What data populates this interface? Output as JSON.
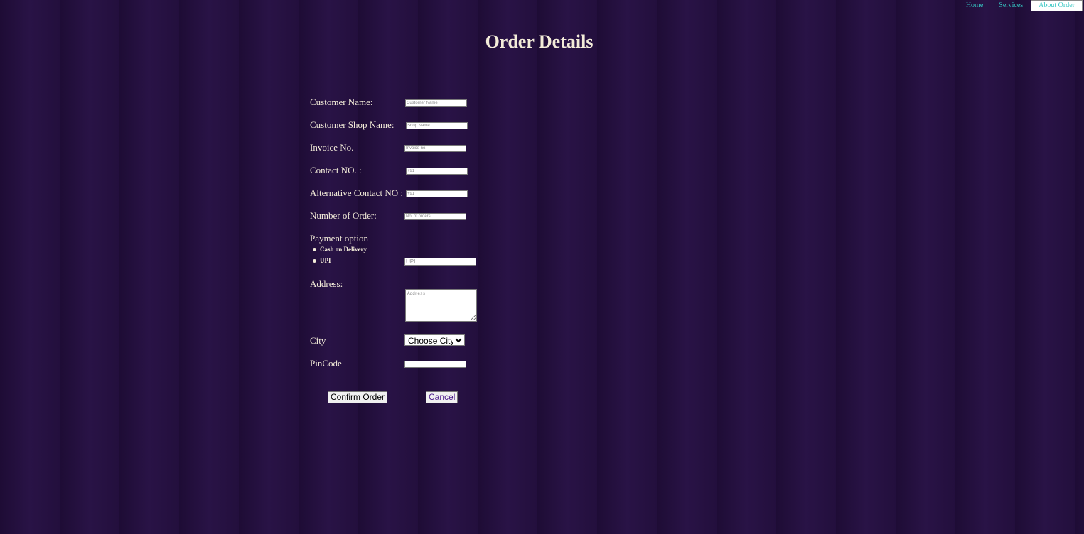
{
  "nav": {
    "home": "Home",
    "services": "Services",
    "about_order": "About Order"
  },
  "page": {
    "title": "Order Details"
  },
  "form": {
    "customer_name": {
      "label": "Customer Name:",
      "placeholder": "Customer Name",
      "value": ""
    },
    "shop_name": {
      "label": "Customer Shop Name:",
      "placeholder": "Shop Name",
      "value": ""
    },
    "invoice_no": {
      "label": "Invoice No.",
      "placeholder": "Invoice no.",
      "value": ""
    },
    "contact_no": {
      "label": "Contact NO. :",
      "placeholder": "+91",
      "value": ""
    },
    "alt_contact_no": {
      "label": "Alternative Contact NO :",
      "placeholder": "+91",
      "value": ""
    },
    "number_of_order": {
      "label": "Number of Order:",
      "placeholder": "No. of orders",
      "value": ""
    },
    "payment": {
      "label": "Payment option",
      "options": [
        "Cash on Delivery",
        "UPI"
      ],
      "upi_placeholder": "UPI"
    },
    "address": {
      "label": "Address:",
      "placeholder": "Address"
    },
    "city": {
      "label": "City",
      "selected": "Choose City"
    },
    "pincode": {
      "label": "PinCode",
      "value": ""
    }
  },
  "buttons": {
    "confirm": "Confirm Order",
    "cancel": "Cancel"
  },
  "colors": {
    "background": "#230f3b",
    "text": "#f3ecd9",
    "nav_link": "#35c6c2"
  }
}
